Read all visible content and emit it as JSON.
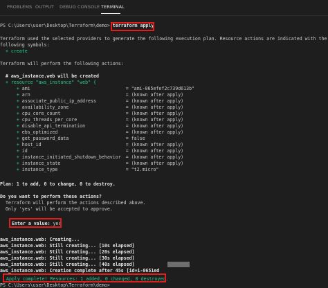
{
  "tabs": [
    "PROBLEMS",
    "OUTPUT",
    "DEBUG CONSOLE",
    "TERMINAL"
  ],
  "active_tab": "TERMINAL",
  "colors": {
    "highlight_box": "#e31c1c",
    "success_green": "#23d18b",
    "add_green": "#23d18b"
  },
  "prompt1": "PS C:\\Users\\user\\Desktop\\Terraform\\demo>",
  "command": "terraform apply",
  "intro1": "Terraform used the selected providers to generate the following execution plan. Resource actions are indicated with the",
  "intro2": "following symbols:",
  "symbol_line": "  + create",
  "will_perform": "Terraform will perform the following actions:",
  "resource_comment": "  # aws_instance.web will be created",
  "resource_open": "  + resource \"aws_instance\" \"web\" {",
  "attributes": [
    {
      "name": "ami",
      "value": "= \"ami-065efef2c739d613b\""
    },
    {
      "name": "arn",
      "value": "= (known after apply)"
    },
    {
      "name": "associate_public_ip_address",
      "value": "= (known after apply)"
    },
    {
      "name": "availability_zone",
      "value": "= (known after apply)"
    },
    {
      "name": "cpu_core_count",
      "value": "= (known after apply)"
    },
    {
      "name": "cpu_threads_per_core",
      "value": "= (known after apply)"
    },
    {
      "name": "disable_api_termination",
      "value": "= (known after apply)"
    },
    {
      "name": "ebs_optimized",
      "value": "= (known after apply)"
    },
    {
      "name": "get_password_data",
      "value": "= false"
    },
    {
      "name": "host_id",
      "value": "= (known after apply)"
    },
    {
      "name": "id",
      "value": "= (known after apply)"
    },
    {
      "name": "instance_initiated_shutdown_behavior",
      "value": "= (known after apply)"
    },
    {
      "name": "instance_state",
      "value": "= (known after apply)"
    },
    {
      "name": "instance_type",
      "value": "= \"t2.micro\""
    }
  ],
  "plan": "Plan: 1 to add, 0 to change, 0 to destroy.",
  "question": "Do you want to perform these actions?",
  "question_desc1": "  Terraform will perform the actions described above.",
  "question_desc2": "  Only 'yes' will be accepted to approve.",
  "enter_label": "Enter a value:",
  "enter_value": "yes",
  "progress": [
    "aws_instance.web: Creating...",
    "aws_instance.web: Still creating... [10s elapsed]",
    "aws_instance.web: Still creating... [20s elapsed]",
    "aws_instance.web: Still creating... [30s elapsed]",
    "aws_instance.web: Still creating... [40s elapsed]",
    "aws_instance.web: Creation complete after 45s [id=i-0651ed"
  ],
  "complete": "Apply complete! Resources: 1 added, 0 changed, 0 destroyed.",
  "prompt2": "PS C:\\Users\\user\\Desktop\\Terraform\\demo>"
}
